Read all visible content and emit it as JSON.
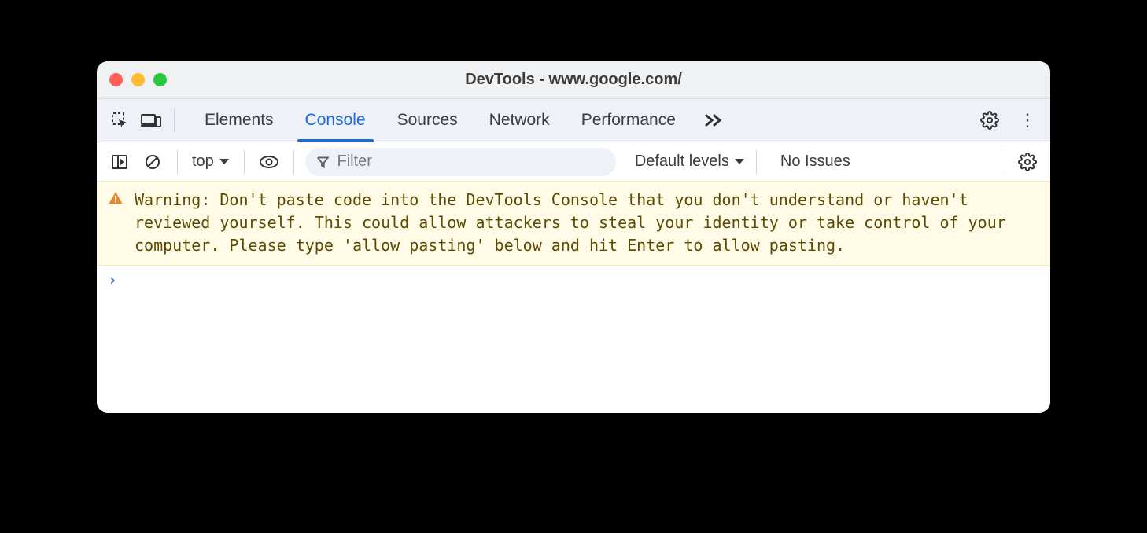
{
  "window": {
    "title": "DevTools - www.google.com/"
  },
  "tabs": {
    "items": [
      "Elements",
      "Console",
      "Sources",
      "Network",
      "Performance"
    ],
    "active_index": 1
  },
  "toolbar": {
    "context_label": "top",
    "filter_placeholder": "Filter",
    "levels_label": "Default levels",
    "issues_label": "No Issues"
  },
  "console": {
    "warning_text": "Warning: Don't paste code into the DevTools Console that you don't understand or haven't reviewed yourself. This could allow attackers to steal your identity or take control of your computer. Please type 'allow pasting' below and hit Enter to allow pasting.",
    "prompt_symbol": "›"
  }
}
